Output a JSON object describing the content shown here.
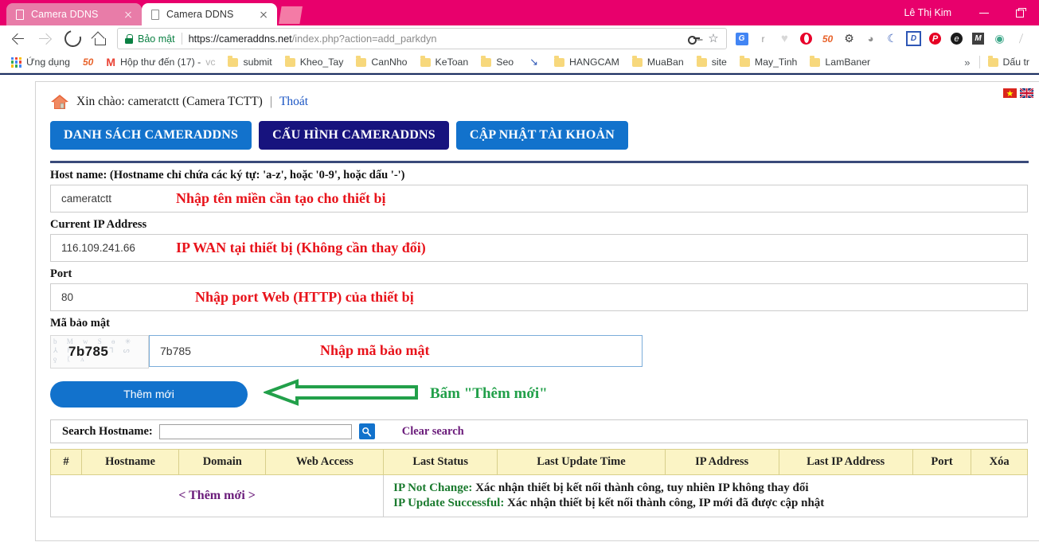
{
  "browser": {
    "tabs": [
      {
        "title": "Camera DDNS",
        "active": false
      },
      {
        "title": "Camera DDNS",
        "active": true
      }
    ],
    "window": {
      "user": "Lê Thị Kim",
      "minimize_label": "minimize",
      "restore_label": "restore"
    },
    "omnibox": {
      "security_label": "Bảo mật",
      "url_host": "https://cameraddns.net",
      "url_path": "/index.php?action=add_parkdyn",
      "full_url": "https://cameraddns.net/index.php?action=add_parkdyn"
    },
    "extensions": [
      {
        "name": "google-translate-icon",
        "glyph": "G"
      },
      {
        "name": "letter-r-icon",
        "glyph": "r"
      },
      {
        "name": "heart-icon",
        "glyph": "♥"
      },
      {
        "name": "opera-icon",
        "glyph": ""
      },
      {
        "name": "fifty-icon",
        "glyph": "50"
      },
      {
        "name": "gear-icon",
        "glyph": "⚙"
      },
      {
        "name": "chat-bubble-icon",
        "glyph": "💬"
      },
      {
        "name": "wifi-icon",
        "glyph": "◟"
      },
      {
        "name": "letter-d-icon",
        "glyph": "D"
      },
      {
        "name": "pinterest-icon",
        "glyph": "P"
      },
      {
        "name": "evernote-icon",
        "glyph": "e"
      },
      {
        "name": "letter-m-icon",
        "glyph": "M"
      },
      {
        "name": "globe-icon",
        "glyph": "◉"
      },
      {
        "name": "brush-icon",
        "glyph": "⟋"
      }
    ],
    "bookmarks": [
      {
        "label": "Ứng dụng",
        "icon": "apps-grid-icon"
      },
      {
        "label": "",
        "icon": "fifty-icon"
      },
      {
        "label": "Hộp thư đến (17) - ",
        "label_dim": "vc",
        "icon": "gmail-icon"
      },
      {
        "label": "submit",
        "icon": "folder-icon"
      },
      {
        "label": "Kheo_Tay",
        "icon": "folder-icon"
      },
      {
        "label": "CanNho",
        "icon": "folder-icon"
      },
      {
        "label": "KeToan",
        "icon": "folder-icon"
      },
      {
        "label": "Seo",
        "icon": "folder-icon"
      },
      {
        "label": "",
        "icon": "swoosh-icon"
      },
      {
        "label": "HANGCAM",
        "icon": "folder-icon"
      },
      {
        "label": "MuaBan",
        "icon": "folder-icon"
      },
      {
        "label": "site",
        "icon": "folder-icon"
      },
      {
        "label": "May_Tinh",
        "icon": "folder-icon"
      },
      {
        "label": "LamBaner",
        "icon": "folder-icon"
      }
    ],
    "bookmarks_overflow": "»",
    "bookmarks_right": {
      "label": "Dấu tr",
      "icon": "folder-icon"
    }
  },
  "page": {
    "flags": [
      {
        "name": "vietnam-flag",
        "title": "Tiếng Việt"
      },
      {
        "name": "uk-flag",
        "title": "English"
      }
    ],
    "greeting_prefix": "Xin chào: cameratctt (Camera TCTT)",
    "greeting_separator": "|",
    "logout_label": "Thoát",
    "nav_tabs": [
      {
        "label": "DANH SÁCH CAMERADDNS",
        "active": false
      },
      {
        "label": "CẤU HÌNH CAMERADDNS",
        "active": true
      },
      {
        "label": "CẬP NHẬT TÀI KHOẢN",
        "active": false
      }
    ],
    "form": {
      "hostname": {
        "label": "Host name: (Hostname chỉ chứa các ký tự: 'a-z', hoặc '0-9', hoặc dấu '-')",
        "value": "cameratctt",
        "annotation": "Nhập tên miền cần tạo cho thiết bị"
      },
      "current_ip": {
        "label": "Current IP Address",
        "value": "116.109.241.66",
        "annotation": "IP WAN tại thiết bị (Không cần thay đổi)"
      },
      "port": {
        "label": "Port",
        "value": "80",
        "annotation": "Nhập port Web (HTTP) của thiết bị"
      },
      "captcha": {
        "label": "Mã bảo mật",
        "image_code": "7b785",
        "value": "7b785",
        "annotation": "Nhập mã bảo mật",
        "noise": "b M w S ɵ\n✳ ⅄ ᖴ ᚦ\nᴎ ᒣ ᔕ ƍ ᛕ ʌ"
      },
      "submit": {
        "label": "Thêm mới",
        "annotation": "Bấm \"Thêm mới\"",
        "arrow_color": "#22a04a"
      }
    },
    "search": {
      "label": "Search Hostname:",
      "value": "",
      "placeholder": "",
      "go_icon": "search-icon",
      "clear_label": "Clear search"
    },
    "table": {
      "headers": [
        "#",
        "Hostname",
        "Domain",
        "Web Access",
        "Last Status",
        "Last Update Time",
        "IP Address",
        "Last IP Address",
        "Port",
        "Xóa"
      ],
      "add_new_label": "< Thêm mới >",
      "legend": [
        {
          "key": "IP Not Change:",
          "text": " Xác nhận thiết bị kết nối thành công, tuy nhiên IP không thay đổi"
        },
        {
          "key": "IP Update Successful:",
          "text": " Xác nhận thiết bị kết nối thành công, IP mới đã được cập nhật"
        }
      ]
    }
  },
  "colors": {
    "browser_accent": "#e8006c",
    "tab_blue": "#1272cc",
    "tab_navy": "#17137e",
    "annotation_red": "#e8131b",
    "annotation_green": "#22a04a",
    "legend_green": "#1a7a2e",
    "link_purple": "#6a1b7a",
    "header_yellow": "#fbf4c5"
  }
}
